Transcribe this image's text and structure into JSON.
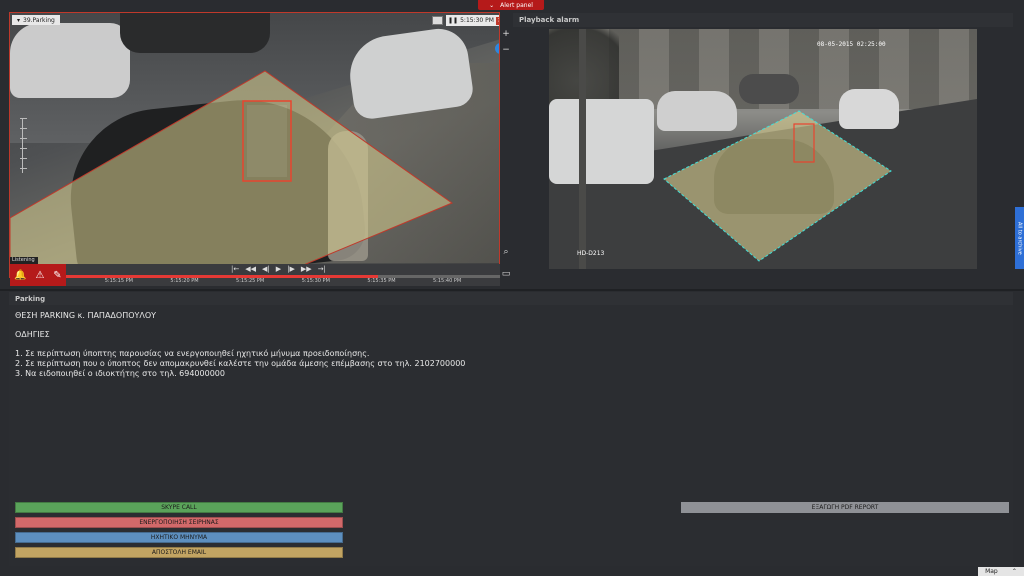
{
  "alert_panel": {
    "label": "Alert panel",
    "chevron": "chevron-down"
  },
  "left_camera": {
    "name": "39.Parking",
    "time": "5:15:30 PM",
    "listening_label": "Listening",
    "timeline_ticks": [
      "5:15:15 PM",
      "5:15:20 PM",
      "5:15:25 PM",
      "5:15:30 PM",
      "5:15:35 PM",
      "5:15:40 PM"
    ],
    "progress": 0.72,
    "controls": [
      "|←",
      "◀◀",
      "◀|",
      "▶",
      "|▶",
      "▶▶",
      "→|"
    ]
  },
  "playback": {
    "title": "Playback alarm",
    "osd_date": "08-05-2015 02:25:00",
    "osd_camera": "HD-D213"
  },
  "side_tab": {
    "label": "All to archive"
  },
  "info_panel": {
    "title": "Parking",
    "heading": "ΘΕΣΗ PARKING κ. ΠΑΠΑΔΟΠΟΥΛΟΥ",
    "subheading": "ΟΔΗΓΙΕΣ",
    "instructions": [
      "1. Σε περίπτωση ύποπτης παρουσίας να ενεργοποιηθεί ηχητικό μήνυμα προειδοποίησης.",
      "2. Σε περίπτωση που ο ύποπτος δεν απομακρυνθεί καλέστε την ομάδα άμεσης επέμβασης στο τηλ. 2102700000",
      "3. Να ειδοποιηθεί ο ιδιοκτήτης στο τηλ. 694000000"
    ]
  },
  "actions": [
    {
      "label": "SKYPE CALL",
      "color": "#5aa35a"
    },
    {
      "label": "ΕΝΕΡΓΟΠΟΙΗΣΗ ΣΕΙΡΗΝΑΣ",
      "color": "#d2696a"
    },
    {
      "label": "ΗΧΗΤΙΚΟ ΜΗΝΥΜΑ",
      "color": "#5d8fbf"
    },
    {
      "label": "ΑΠΟΣΤΟΛΗ EMAIL",
      "color": "#c2a462"
    }
  ],
  "pdf_button": {
    "label": "ΕΞΑΓΩΓΗ PDF REPORT"
  },
  "map_tab": {
    "label": "Map"
  },
  "colors": {
    "alert_red": "#b51a1a",
    "zone_fill": "#d8cf8f",
    "zone_edge_left": "#c0392b",
    "zone_edge_right": "#3fe0d8",
    "accent_blue": "#2e6fd6"
  }
}
